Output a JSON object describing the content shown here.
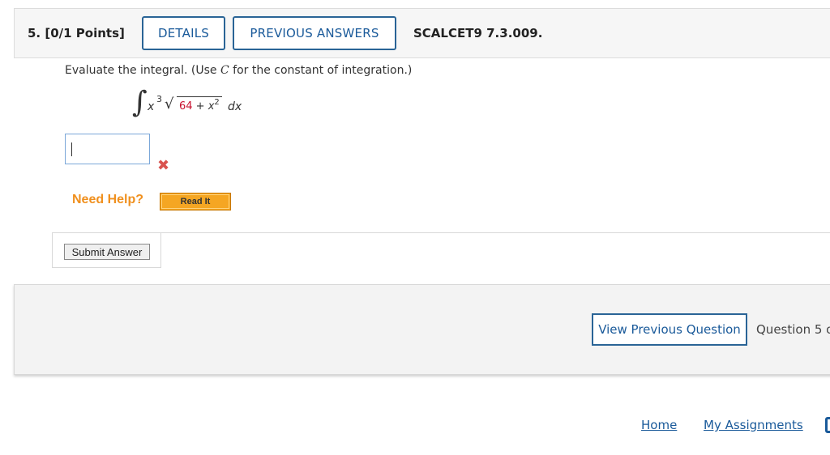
{
  "question": {
    "number_points": "5. [0/1 Points]",
    "details_label": "DETAILS",
    "previous_answers_label": "PREVIOUS ANSWERS",
    "reference": "SCALCET9 7.3.009."
  },
  "prompt": {
    "before": "Evaluate the integral. (Use ",
    "var": "C",
    "after": " for the constant of integration.)"
  },
  "integral": {
    "sign": "∫",
    "base": "x",
    "exponent": "3",
    "root_symbol": "√",
    "radicand_const": "64",
    "radicand_op": " + ",
    "radicand_var": "x",
    "radicand_exp": "2",
    "differential": "dx"
  },
  "answer": {
    "value": "",
    "status": "incorrect",
    "status_color": "#d9534f"
  },
  "help": {
    "label": "Need Help?",
    "read_it_label": "Read It"
  },
  "submit": {
    "label": "Submit Answer"
  },
  "footer": {
    "view_previous_label": "View Previous Question",
    "question_progress": "Question 5 o"
  },
  "links": {
    "home": "Home",
    "my_assignments": "My Assignments"
  },
  "colors": {
    "accent": "#1a5a9a",
    "help_orange": "#f0901e",
    "radicand_red": "#c8102e"
  }
}
